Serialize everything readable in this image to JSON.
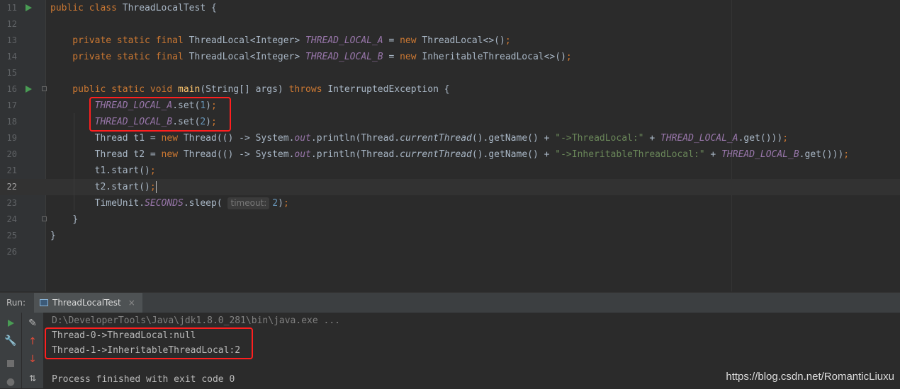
{
  "editor": {
    "lines": [
      {
        "num": "11",
        "tokens": [
          {
            "t": "public class ",
            "c": "kw"
          },
          {
            "t": "ThreadLocalTest {",
            "c": ""
          }
        ]
      },
      {
        "num": "12",
        "tokens": []
      },
      {
        "num": "13",
        "tokens": [
          {
            "t": "    private static final ",
            "c": "kw"
          },
          {
            "t": "ThreadLocal<Integer> ",
            "c": ""
          },
          {
            "t": "THREAD_LOCAL_A",
            "c": "st"
          },
          {
            "t": " = ",
            "c": ""
          },
          {
            "t": "new ",
            "c": "kw"
          },
          {
            "t": "ThreadLocal<>()",
            "c": ""
          },
          {
            "t": ";",
            "c": "kw"
          }
        ]
      },
      {
        "num": "14",
        "tokens": [
          {
            "t": "    private static final ",
            "c": "kw"
          },
          {
            "t": "ThreadLocal<Integer> ",
            "c": ""
          },
          {
            "t": "THREAD_LOCAL_B",
            "c": "st"
          },
          {
            "t": " = ",
            "c": ""
          },
          {
            "t": "new ",
            "c": "kw"
          },
          {
            "t": "InheritableThreadLocal<>()",
            "c": ""
          },
          {
            "t": ";",
            "c": "kw"
          }
        ]
      },
      {
        "num": "15",
        "tokens": []
      },
      {
        "num": "16",
        "tokens": [
          {
            "t": "    public static void ",
            "c": "kw"
          },
          {
            "t": "main",
            "c": "fn"
          },
          {
            "t": "(String[] args) ",
            "c": ""
          },
          {
            "t": "throws ",
            "c": "kw"
          },
          {
            "t": "InterruptedException {",
            "c": ""
          }
        ]
      },
      {
        "num": "17",
        "tokens": [
          {
            "t": "        ",
            "c": ""
          },
          {
            "t": "THREAD_LOCAL_A",
            "c": "st"
          },
          {
            "t": ".set(",
            "c": ""
          },
          {
            "t": "1",
            "c": "num"
          },
          {
            "t": ")",
            "c": ""
          },
          {
            "t": ";",
            "c": "kw"
          }
        ]
      },
      {
        "num": "18",
        "tokens": [
          {
            "t": "        ",
            "c": ""
          },
          {
            "t": "THREAD_LOCAL_B",
            "c": "st"
          },
          {
            "t": ".set(",
            "c": ""
          },
          {
            "t": "2",
            "c": "num"
          },
          {
            "t": ")",
            "c": ""
          },
          {
            "t": ";",
            "c": "kw"
          }
        ]
      },
      {
        "num": "19",
        "tokens": [
          {
            "t": "        Thread t1 = ",
            "c": ""
          },
          {
            "t": "new ",
            "c": "kw"
          },
          {
            "t": "Thread(() -> System.",
            "c": ""
          },
          {
            "t": "out",
            "c": "st"
          },
          {
            "t": ".println(Thread.",
            "c": ""
          },
          {
            "t": "currentThread",
            "c": "it"
          },
          {
            "t": "().getName() + ",
            "c": ""
          },
          {
            "t": "\"->ThreadLocal:\"",
            "c": "str"
          },
          {
            "t": " + ",
            "c": ""
          },
          {
            "t": "THREAD_LOCAL_A",
            "c": "st"
          },
          {
            "t": ".get()))",
            "c": ""
          },
          {
            "t": ";",
            "c": "kw"
          }
        ]
      },
      {
        "num": "20",
        "tokens": [
          {
            "t": "        Thread t2 = ",
            "c": ""
          },
          {
            "t": "new ",
            "c": "kw"
          },
          {
            "t": "Thread(() -> System.",
            "c": ""
          },
          {
            "t": "out",
            "c": "st"
          },
          {
            "t": ".println(Thread.",
            "c": ""
          },
          {
            "t": "currentThread",
            "c": "it"
          },
          {
            "t": "().getName() + ",
            "c": ""
          },
          {
            "t": "\"->InheritableThreadLocal:\"",
            "c": "str"
          },
          {
            "t": " + ",
            "c": ""
          },
          {
            "t": "THREAD_LOCAL_B",
            "c": "st"
          },
          {
            "t": ".get()))",
            "c": ""
          },
          {
            "t": ";",
            "c": "kw"
          }
        ]
      },
      {
        "num": "21",
        "tokens": [
          {
            "t": "        t1.start()",
            "c": ""
          },
          {
            "t": ";",
            "c": "kw"
          }
        ]
      },
      {
        "num": "22",
        "tokens": [
          {
            "t": "        t2.start()",
            "c": ""
          },
          {
            "t": ";",
            "c": "kw"
          },
          {
            "t": "",
            "c": "caret"
          }
        ]
      },
      {
        "num": "23",
        "tokens": [
          {
            "t": "        TimeUnit.",
            "c": ""
          },
          {
            "t": "SECONDS",
            "c": "st"
          },
          {
            "t": ".sleep( ",
            "c": ""
          },
          {
            "t": "timeout:",
            "c": "hint"
          },
          {
            "t": "2",
            "c": "num"
          },
          {
            "t": ")",
            "c": ""
          },
          {
            "t": ";",
            "c": "kw"
          }
        ]
      },
      {
        "num": "24",
        "tokens": [
          {
            "t": "    }",
            "c": ""
          }
        ]
      },
      {
        "num": "25",
        "tokens": [
          {
            "t": "}",
            "c": ""
          }
        ]
      },
      {
        "num": "26",
        "tokens": []
      }
    ]
  },
  "run_panel": {
    "label": "Run:",
    "tab_title": "ThreadLocalTest",
    "tab_close": "×"
  },
  "console": {
    "command": "D:\\DeveloperTools\\Java\\jdk1.8.0_281\\bin\\java.exe ...",
    "output_1": "Thread-0->ThreadLocal:null",
    "output_2": "Thread-1->InheritableThreadLocal:2",
    "exit_message": "Process finished with exit code 0"
  },
  "watermark": "https://blog.csdn.net/RomanticLiuxu",
  "colors": {
    "highlight_box": "#ff1f1f",
    "keyword": "#cc7832",
    "static_field": "#9876aa",
    "string": "#6a8759",
    "number": "#6897bb"
  }
}
